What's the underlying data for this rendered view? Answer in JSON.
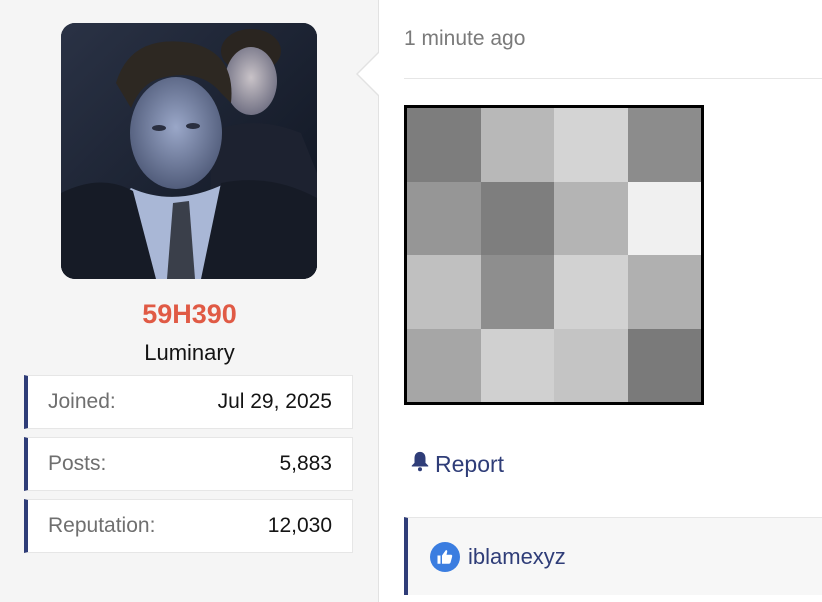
{
  "user": {
    "username": "59H390",
    "title": "Luminary",
    "username_color": "#e05a45",
    "stats": [
      {
        "label": "Joined:",
        "value": "Jul 29, 2025"
      },
      {
        "label": "Posts:",
        "value": "5,883"
      },
      {
        "label": "Reputation:",
        "value": "12,030"
      }
    ]
  },
  "message": {
    "timestamp": "1 minute ago",
    "attachment_grid": [
      [
        "#7d7d7d",
        "#b8b8b8",
        "#d4d4d4",
        "#8c8c8c"
      ],
      [
        "#969696",
        "#7e7e7e",
        "#b4b4b4",
        "#f0f0f0"
      ],
      [
        "#c0c0c0",
        "#8e8e8e",
        "#d2d2d2",
        "#b0b0b0"
      ],
      [
        "#a6a6a6",
        "#d0d0d0",
        "#c4c4c4",
        "#7a7a7a"
      ]
    ],
    "report_label": "Report",
    "reactions": {
      "icon": "like-icon",
      "users": "iblamexyz"
    }
  },
  "colors": {
    "accent": "#2f3d78",
    "like_blue": "#3b7de0"
  }
}
